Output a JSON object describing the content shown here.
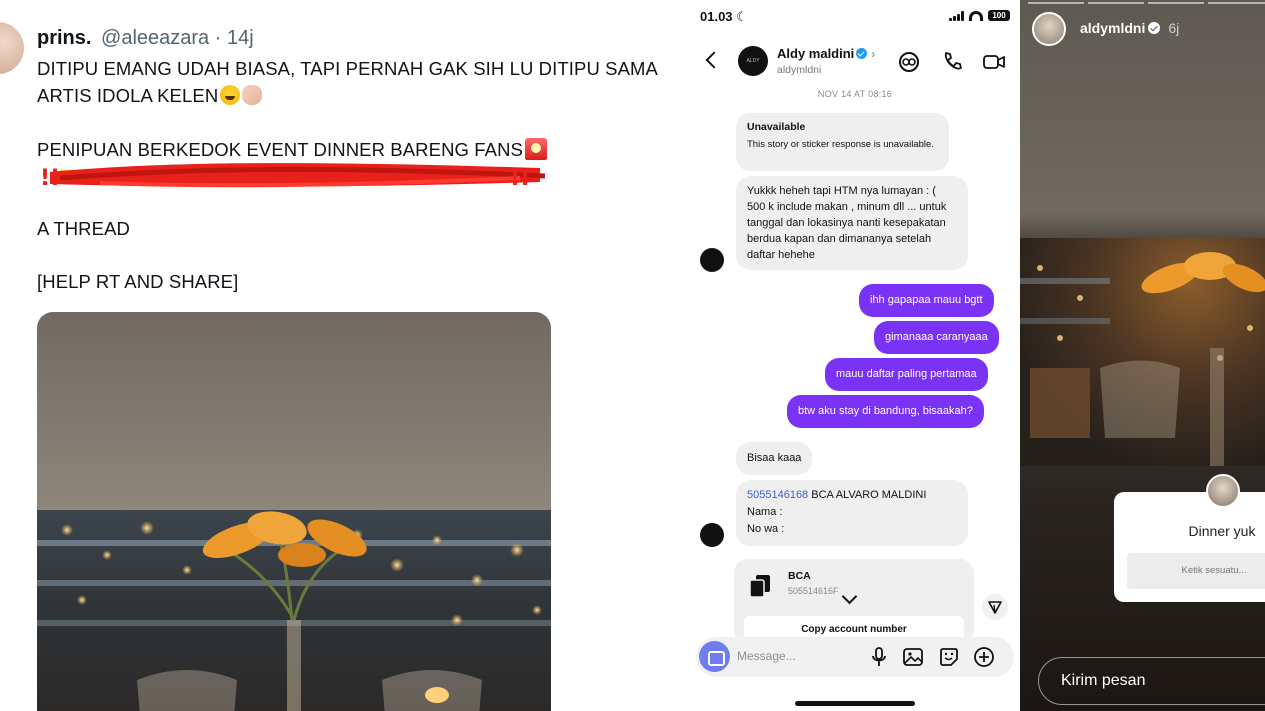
{
  "tweet": {
    "name": "prins.",
    "handle": "@aleeazara",
    "separator": "·",
    "time": "14j",
    "line1": "DITIPU EMANG UDAH BIASA, TAPI PERNAH GAK SIH LU DITIPU SAMA",
    "line2": "ARTIS IDOLA KELEN",
    "line3": "PENIPUAN BERKEDOK EVENT DINNER BARENG FANS",
    "line5": "A THREAD",
    "line6": "[HELP RT AND SHARE]",
    "redaction_prefix": "!!",
    "redaction_suffix": "!!"
  },
  "dm": {
    "status_time": "01.03",
    "battery": "100",
    "contact_name": "Aldy maldini",
    "contact_handle": "aldymldni",
    "date": "NOV 14 AT 08:16",
    "unavailable_title": "Unavailable",
    "unavailable_body": "This story or sticker response is unavailable.",
    "msg1": "Yukkk heheh tapi HTM nya lumayan : ( 500 k include makan , minum dll ... untuk tanggal dan lokasinya nanti kesepakatan berdua kapan dan dimananya setelah daftar hehehe",
    "out1": "ihh gapapaa mauu bgtt",
    "out2": "gimanaaa caranyaaa",
    "out3": "mauu daftar paling pertamaa",
    "out4": "btw aku stay di bandung, bisaakah?",
    "msg2": "Bisaa kaaa",
    "acct_number": "5055146168",
    "acct_name": " BCA ALVARO MALDINI",
    "nama": "Nama :",
    "nowa": "No wa :",
    "card_bank": "BCA",
    "card_number": "505514616F",
    "card_copy": "Copy account number",
    "composer_placeholder": "Message..."
  },
  "story": {
    "user": "aldymldni",
    "time_ago": "6j",
    "question": "Dinner yuk",
    "question_placeholder": "Ketik sesuatu...",
    "reply_placeholder": "Kirim pesan"
  }
}
